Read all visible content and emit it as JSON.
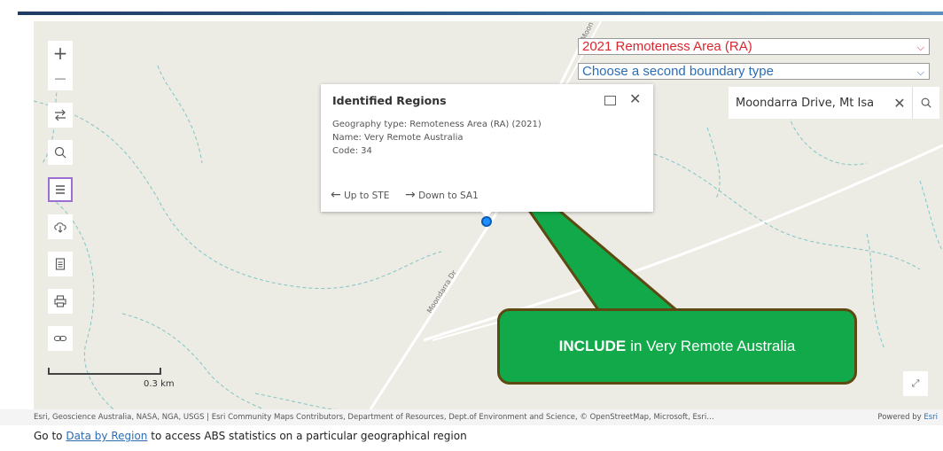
{
  "toolbar": {
    "zoom_in": "+",
    "zoom_out": "—",
    "icons": [
      "swap-icon",
      "search-icon",
      "list-icon",
      "download-icon",
      "report-icon",
      "print-icon",
      "link-icon"
    ]
  },
  "boundary": {
    "primary": "2021 Remoteness Area (RA)",
    "secondary": "Choose a second boundary type",
    "primary_color": "#d9272e",
    "secondary_color": "#2a6db5"
  },
  "search": {
    "value": "Moondarra Drive, Mt Isa",
    "clear": "✕"
  },
  "popup": {
    "title": "Identified Regions",
    "geography": "Geography type: Remoteness Area (RA) (2021)",
    "name": "Name: Very Remote Australia",
    "code": "Code: 34",
    "up": "Up to STE",
    "down": "Down to SA1",
    "close": "✕"
  },
  "callout": {
    "bold": "INCLUDE",
    "text": "in Very Remote Australia",
    "color": "#12a94a"
  },
  "map": {
    "road_label_1": "Moondarra Dr",
    "road_label_2": "Moon",
    "scale": "0.3 km"
  },
  "attribution": {
    "text": "Esri, Geoscience Australia, NASA, NGA, USGS | Esri Community Maps Contributors, Department of Resources, Dept.of Environment and Science, © OpenStreetMap, Microsoft, Esri…",
    "powered_prefix": "Powered by ",
    "powered_link": "Esri"
  },
  "footer": {
    "prefix": "Go to ",
    "link": "Data by Region",
    "suffix": " to access ABS statistics on a particular geographical region"
  }
}
